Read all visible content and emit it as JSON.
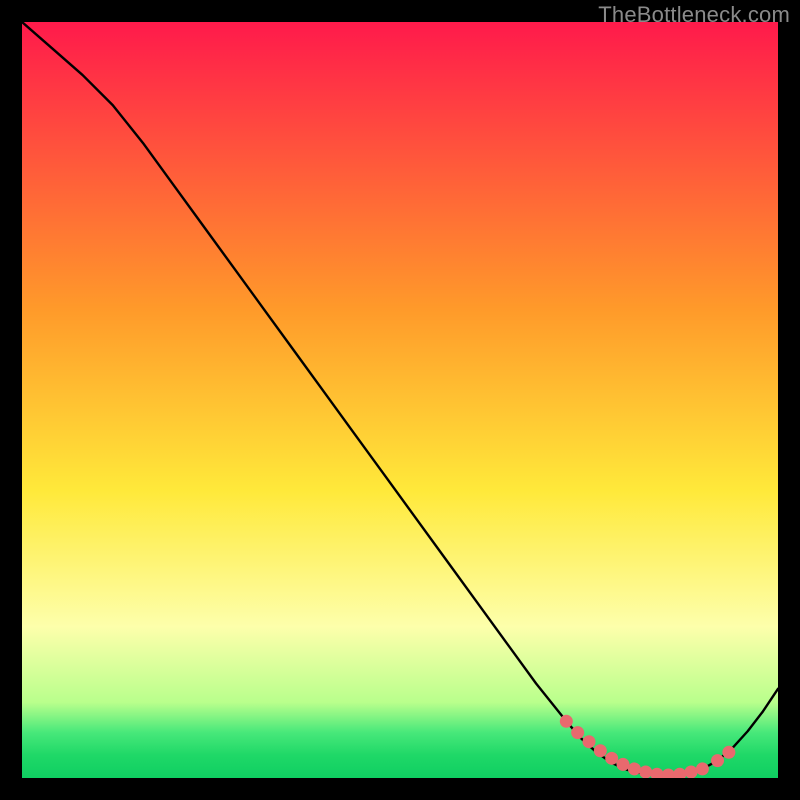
{
  "watermark": "TheBottleneck.com",
  "colors": {
    "bg": "#000000",
    "curve": "#000000",
    "marker": "#e9696e",
    "grad_top": "#ff1a4b",
    "grad_orange": "#ff9a2a",
    "grad_yellow": "#ffe93a",
    "grad_paleyellow": "#fdffab",
    "grad_green1": "#b9ff8c",
    "grad_green2": "#47e87a",
    "grad_green3": "#1fd867",
    "grad_green4": "#0fcf62"
  },
  "chart_data": {
    "type": "line",
    "title": "",
    "xlabel": "",
    "ylabel": "",
    "xlim": [
      0,
      100
    ],
    "ylim": [
      0,
      100
    ],
    "series": [
      {
        "name": "curve",
        "x": [
          0,
          4,
          8,
          12,
          16,
          20,
          24,
          28,
          32,
          36,
          40,
          44,
          48,
          52,
          56,
          60,
          64,
          68,
          72,
          74,
          76,
          78,
          80,
          82,
          84,
          86,
          88,
          90,
          92,
          94,
          96,
          98,
          100
        ],
        "y": [
          100,
          96.5,
          93,
          89,
          84,
          78.5,
          73,
          67.5,
          62,
          56.5,
          51,
          45.5,
          40,
          34.5,
          29,
          23.5,
          18,
          12.5,
          7.5,
          5.2,
          3.4,
          2.0,
          1.1,
          0.6,
          0.4,
          0.4,
          0.6,
          1.2,
          2.3,
          4.0,
          6.2,
          8.8,
          11.8
        ]
      }
    ],
    "markers": {
      "name": "floor-markers",
      "x": [
        72,
        73.5,
        75,
        76.5,
        78,
        79.5,
        81,
        82.5,
        84,
        85.5,
        87,
        88.5,
        90,
        92,
        93.5
      ],
      "y": [
        7.5,
        6.0,
        4.8,
        3.6,
        2.6,
        1.8,
        1.2,
        0.8,
        0.5,
        0.4,
        0.5,
        0.8,
        1.2,
        2.3,
        3.4
      ]
    }
  }
}
